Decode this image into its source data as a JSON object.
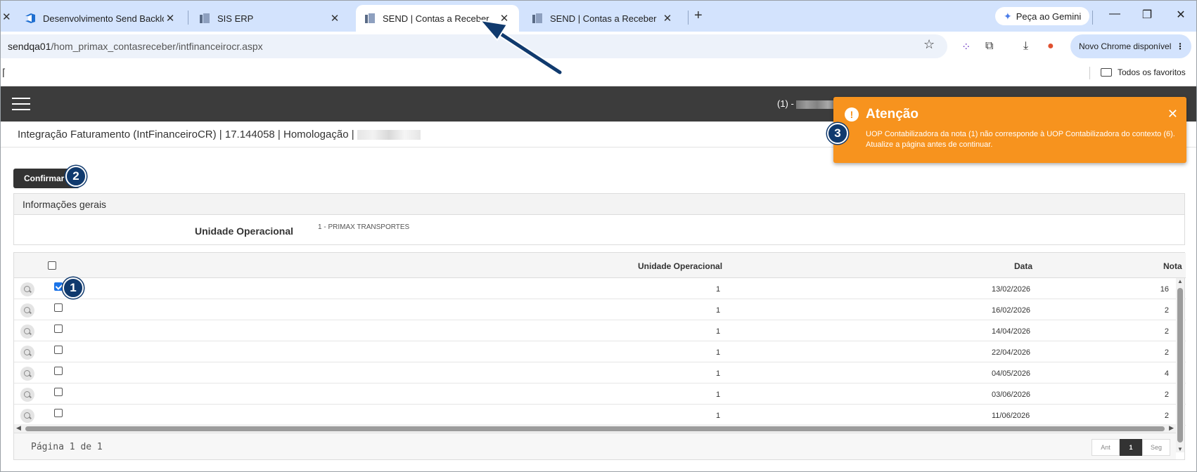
{
  "browser": {
    "tabs": [
      {
        "title": "Desenvolvimento Send Backlog",
        "active": false
      },
      {
        "title": "SIS ERP",
        "active": false
      },
      {
        "title": "SEND | Contas a Receber",
        "active": true
      },
      {
        "title": "SEND | Contas a Receber",
        "active": false
      }
    ],
    "gemini_label": "Peça ao Gemini",
    "url_host": "sendqa01",
    "url_path": "/hom_primax_contasreceber/intfinanceirocr.aspx",
    "new_chrome_label": "Novo Chrome disponível",
    "bookmarks_label": "Todos os favoritos"
  },
  "app": {
    "context_prefix": "(1) -",
    "subtitle": "Integração Faturamento (IntFinanceiroCR) | 17.144058 | Homologação |",
    "confirm_label": "Confirmar",
    "info": {
      "header": "Informações gerais",
      "label": "Unidade Operacional",
      "value": "1 - PRIMAX TRANSPORTES"
    },
    "grid": {
      "columns": [
        "Unidade Operacional",
        "Data",
        "Nota"
      ],
      "rows": [
        {
          "unit": "1",
          "date": "13/02/2026",
          "nota": "16",
          "checked": true
        },
        {
          "unit": "1",
          "date": "16/02/2026",
          "nota": "2",
          "checked": false
        },
        {
          "unit": "1",
          "date": "14/04/2026",
          "nota": "2",
          "checked": false
        },
        {
          "unit": "1",
          "date": "22/04/2026",
          "nota": "2",
          "checked": false
        },
        {
          "unit": "1",
          "date": "04/05/2026",
          "nota": "4",
          "checked": false
        },
        {
          "unit": "1",
          "date": "03/06/2026",
          "nota": "2",
          "checked": false
        },
        {
          "unit": "1",
          "date": "11/06/2026",
          "nota": "2",
          "checked": false
        }
      ],
      "page_info": "Página 1 de 1",
      "pager": {
        "prev": "Ant",
        "current": "1",
        "next": "Seg"
      }
    }
  },
  "toast": {
    "title": "Atenção",
    "icon": "!",
    "message": "UOP Contabilizadora da nota (1) não corresponde à UOP Contabilizadora do contexto (6). Atualize a página antes de continuar."
  },
  "badges": {
    "one": "1",
    "two": "2",
    "three": "3"
  },
  "colors": {
    "toast": "#f7931e",
    "header": "#3c3c3c",
    "badge": "#103a6e",
    "tabstrip": "#d3e3fd"
  }
}
